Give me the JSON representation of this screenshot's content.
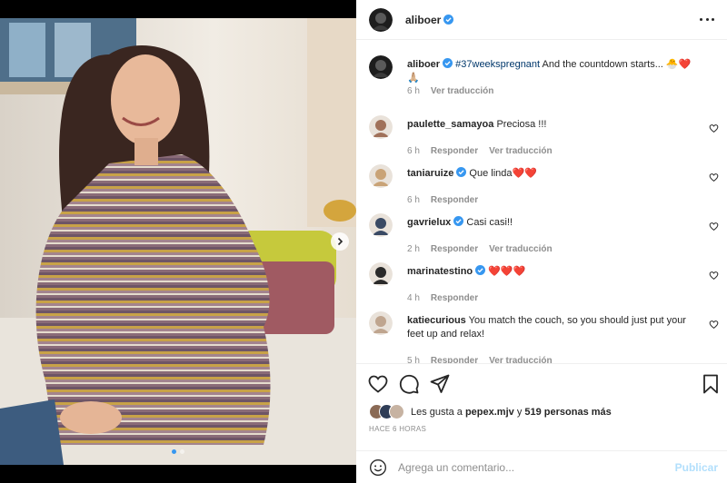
{
  "post": {
    "author": "aliboer",
    "verified": true,
    "more_icon": "more-horizontal-icon",
    "caption": {
      "user": "aliboer",
      "hashtag": "#37weekspregnant",
      "text": " And the countdown starts... 🐣❤️🙏🏼",
      "time": "6 h",
      "translate": "Ver traducción"
    }
  },
  "comments": [
    {
      "user": "paulette_samayoa",
      "verified": false,
      "text": "Preciosa !!!",
      "time": "6 h",
      "reply": "Responder",
      "translate": "Ver traducción",
      "avatar_color": "#a0715a"
    },
    {
      "user": "taniaruize",
      "verified": true,
      "text": "Que linda❤️❤️",
      "time": "6 h",
      "reply": "Responder",
      "translate": "",
      "avatar_color": "#c9a377"
    },
    {
      "user": "gavrielux",
      "verified": true,
      "text": "Casi casi!!",
      "time": "2 h",
      "reply": "Responder",
      "translate": "Ver traducción",
      "avatar_color": "#3a4a64"
    },
    {
      "user": "marinatestino",
      "verified": true,
      "text": "❤️❤️❤️",
      "time": "4 h",
      "reply": "Responder",
      "translate": "",
      "avatar_color": "#2a2a2a"
    },
    {
      "user": "katiecurious",
      "verified": false,
      "text": "You match the couch, so you should just put your feet up and relax!",
      "time": "5 h",
      "reply": "Responder",
      "translate": "Ver traducción",
      "avatar_color": "#bfa58f"
    }
  ],
  "actions": {
    "icons": [
      "heart-icon",
      "comment-icon",
      "share-icon",
      "bookmark-icon"
    ],
    "likes_prefix": "Les gusta a ",
    "likes_user": "pepex.mjv",
    "likes_mid": " y ",
    "likes_count": "519 personas más",
    "posted": "HACE 6 HORAS"
  },
  "comment_box": {
    "placeholder": "Agrega un comentario...",
    "post_label": "Publicar"
  },
  "carousel": {
    "slides": 2,
    "current": 1
  },
  "colors": {
    "accent": "#3797f0",
    "link": "#00376b",
    "muted": "#8e8e8e",
    "post_disabled": "#b2dffc",
    "heart_red": "#ed4956"
  }
}
